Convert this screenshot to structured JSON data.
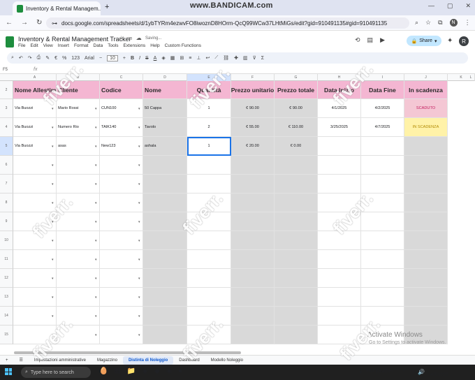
{
  "browser": {
    "tab_title": "Inventory & Rental Managem...",
    "watermark_top": "www.BANDICAM.com",
    "url": "docs.google.com/spreadsheets/d/1ybTYRm4ezwvFO8iwoznD8HOrm-QcQ99WCw37LHtMiGs/edit?gid=910491135#gid=910491135"
  },
  "sheets": {
    "title": "Inventory & Rental Management Tracker",
    "saving": "Saving...",
    "menus": [
      "File",
      "Edit",
      "View",
      "Insert",
      "Format",
      "Data",
      "Tools",
      "Extensions",
      "Help",
      "Custom Functions"
    ],
    "share_label": "Share",
    "avatar_letter": "R",
    "font_name": "Arial",
    "font_size": "10",
    "zoom_percent": "123",
    "name_box": "F5"
  },
  "grid": {
    "columns": [
      "A",
      "B",
      "C",
      "D",
      "E",
      "F",
      "G",
      "H",
      "I",
      "J",
      "K",
      "L"
    ],
    "row_numbers": [
      "2",
      "3",
      "4",
      "5",
      "6",
      "7",
      "8",
      "9",
      "10",
      "11",
      "12",
      "13",
      "14",
      "15"
    ],
    "headers": [
      "Nome Allestime",
      "Cliente",
      "Codice",
      "Nome",
      "Quantità",
      "Prezzo unitario",
      "Prezzo totale",
      "Data Inizio",
      "Data Fine",
      "In scadenza"
    ],
    "rows": [
      {
        "nome_allestimento": "Via Buozzi",
        "cliente": "Mario Rossi",
        "codice": "CUN100",
        "nome": "50 Cappa",
        "quantita": "1",
        "prezzo_unitario": "€ 90.00",
        "prezzo_totale": "€ 90.00",
        "data_inizio": "4/1/2025",
        "data_fine": "4/2/2025",
        "scadenza": "SCADUTO",
        "scadenza_color": "#f4c7d4"
      },
      {
        "nome_allestimento": "Via Buozzi",
        "cliente": "Numero Rio",
        "codice": "TAIK140",
        "nome": "Tavolo",
        "quantita": "2",
        "prezzo_unitario": "€ 55.00",
        "prezzo_totale": "€ 110.00",
        "data_inizio": "3/25/2025",
        "data_fine": "4/7/2025",
        "scadenza": "IN SCADENZA",
        "scadenza_color": "#fff2a8"
      },
      {
        "nome_allestimento": "Via Buozzi",
        "cliente": "asas",
        "codice": "New123",
        "nome": "ashala",
        "quantita": "1",
        "prezzo_unitario": "€ 20.00",
        "prezzo_totale": "€ 0.00",
        "data_inizio": "",
        "data_fine": "",
        "scadenza": "",
        "scadenza_color": ""
      }
    ]
  },
  "sheet_tabs": [
    "Impostazioni amministrative",
    "Magazzino",
    "Distinta di Noleggio",
    "Dashboard",
    "Modello Noleggio"
  ],
  "active_sheet_tab": "Distinta di Noleggio",
  "activate_windows": {
    "title": "Activate Windows",
    "subtitle": "Go to Settings to activate Windows."
  },
  "watermark": "fiverr.",
  "taskbar": {
    "search_placeholder": "Type here to search",
    "weather": "Hot weather",
    "time": "3:44 PM",
    "date": "4/5/2025"
  }
}
